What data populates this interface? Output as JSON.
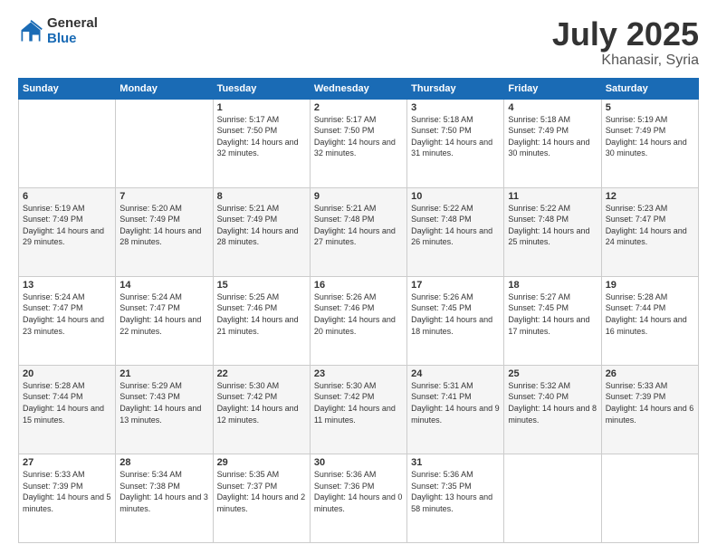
{
  "header": {
    "logo_general": "General",
    "logo_blue": "Blue",
    "title": "July 2025",
    "location": "Khanasir, Syria"
  },
  "days_of_week": [
    "Sunday",
    "Monday",
    "Tuesday",
    "Wednesday",
    "Thursday",
    "Friday",
    "Saturday"
  ],
  "weeks": [
    [
      {
        "day": "",
        "info": ""
      },
      {
        "day": "",
        "info": ""
      },
      {
        "day": "1",
        "info": "Sunrise: 5:17 AM\nSunset: 7:50 PM\nDaylight: 14 hours and 32 minutes."
      },
      {
        "day": "2",
        "info": "Sunrise: 5:17 AM\nSunset: 7:50 PM\nDaylight: 14 hours and 32 minutes."
      },
      {
        "day": "3",
        "info": "Sunrise: 5:18 AM\nSunset: 7:50 PM\nDaylight: 14 hours and 31 minutes."
      },
      {
        "day": "4",
        "info": "Sunrise: 5:18 AM\nSunset: 7:49 PM\nDaylight: 14 hours and 30 minutes."
      },
      {
        "day": "5",
        "info": "Sunrise: 5:19 AM\nSunset: 7:49 PM\nDaylight: 14 hours and 30 minutes."
      }
    ],
    [
      {
        "day": "6",
        "info": "Sunrise: 5:19 AM\nSunset: 7:49 PM\nDaylight: 14 hours and 29 minutes."
      },
      {
        "day": "7",
        "info": "Sunrise: 5:20 AM\nSunset: 7:49 PM\nDaylight: 14 hours and 28 minutes."
      },
      {
        "day": "8",
        "info": "Sunrise: 5:21 AM\nSunset: 7:49 PM\nDaylight: 14 hours and 28 minutes."
      },
      {
        "day": "9",
        "info": "Sunrise: 5:21 AM\nSunset: 7:48 PM\nDaylight: 14 hours and 27 minutes."
      },
      {
        "day": "10",
        "info": "Sunrise: 5:22 AM\nSunset: 7:48 PM\nDaylight: 14 hours and 26 minutes."
      },
      {
        "day": "11",
        "info": "Sunrise: 5:22 AM\nSunset: 7:48 PM\nDaylight: 14 hours and 25 minutes."
      },
      {
        "day": "12",
        "info": "Sunrise: 5:23 AM\nSunset: 7:47 PM\nDaylight: 14 hours and 24 minutes."
      }
    ],
    [
      {
        "day": "13",
        "info": "Sunrise: 5:24 AM\nSunset: 7:47 PM\nDaylight: 14 hours and 23 minutes."
      },
      {
        "day": "14",
        "info": "Sunrise: 5:24 AM\nSunset: 7:47 PM\nDaylight: 14 hours and 22 minutes."
      },
      {
        "day": "15",
        "info": "Sunrise: 5:25 AM\nSunset: 7:46 PM\nDaylight: 14 hours and 21 minutes."
      },
      {
        "day": "16",
        "info": "Sunrise: 5:26 AM\nSunset: 7:46 PM\nDaylight: 14 hours and 20 minutes."
      },
      {
        "day": "17",
        "info": "Sunrise: 5:26 AM\nSunset: 7:45 PM\nDaylight: 14 hours and 18 minutes."
      },
      {
        "day": "18",
        "info": "Sunrise: 5:27 AM\nSunset: 7:45 PM\nDaylight: 14 hours and 17 minutes."
      },
      {
        "day": "19",
        "info": "Sunrise: 5:28 AM\nSunset: 7:44 PM\nDaylight: 14 hours and 16 minutes."
      }
    ],
    [
      {
        "day": "20",
        "info": "Sunrise: 5:28 AM\nSunset: 7:44 PM\nDaylight: 14 hours and 15 minutes."
      },
      {
        "day": "21",
        "info": "Sunrise: 5:29 AM\nSunset: 7:43 PM\nDaylight: 14 hours and 13 minutes."
      },
      {
        "day": "22",
        "info": "Sunrise: 5:30 AM\nSunset: 7:42 PM\nDaylight: 14 hours and 12 minutes."
      },
      {
        "day": "23",
        "info": "Sunrise: 5:30 AM\nSunset: 7:42 PM\nDaylight: 14 hours and 11 minutes."
      },
      {
        "day": "24",
        "info": "Sunrise: 5:31 AM\nSunset: 7:41 PM\nDaylight: 14 hours and 9 minutes."
      },
      {
        "day": "25",
        "info": "Sunrise: 5:32 AM\nSunset: 7:40 PM\nDaylight: 14 hours and 8 minutes."
      },
      {
        "day": "26",
        "info": "Sunrise: 5:33 AM\nSunset: 7:39 PM\nDaylight: 14 hours and 6 minutes."
      }
    ],
    [
      {
        "day": "27",
        "info": "Sunrise: 5:33 AM\nSunset: 7:39 PM\nDaylight: 14 hours and 5 minutes."
      },
      {
        "day": "28",
        "info": "Sunrise: 5:34 AM\nSunset: 7:38 PM\nDaylight: 14 hours and 3 minutes."
      },
      {
        "day": "29",
        "info": "Sunrise: 5:35 AM\nSunset: 7:37 PM\nDaylight: 14 hours and 2 minutes."
      },
      {
        "day": "30",
        "info": "Sunrise: 5:36 AM\nSunset: 7:36 PM\nDaylight: 14 hours and 0 minutes."
      },
      {
        "day": "31",
        "info": "Sunrise: 5:36 AM\nSunset: 7:35 PM\nDaylight: 13 hours and 58 minutes."
      },
      {
        "day": "",
        "info": ""
      },
      {
        "day": "",
        "info": ""
      }
    ]
  ]
}
